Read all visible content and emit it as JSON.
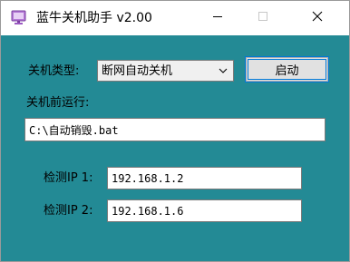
{
  "window": {
    "title": "蓝牛关机助手 v2.00",
    "icon": "monitor-app-icon",
    "controls": {
      "minimize_icon": "minimize-icon",
      "maximize_icon": "maximize-icon",
      "close_icon": "close-icon"
    },
    "background_color": "#238a95"
  },
  "form": {
    "shutdown_type_label": "关机类型:",
    "shutdown_type_selected": "断网自动关机",
    "start_button_label": "启动",
    "pre_run_label": "关机前运行:",
    "pre_run_value": "C:\\自动销毁.bat",
    "ip1_label": "检测IP 1:",
    "ip1_value": "192.168.1.2",
    "ip2_label": "检测IP 2:",
    "ip2_value": "192.168.1.6"
  }
}
